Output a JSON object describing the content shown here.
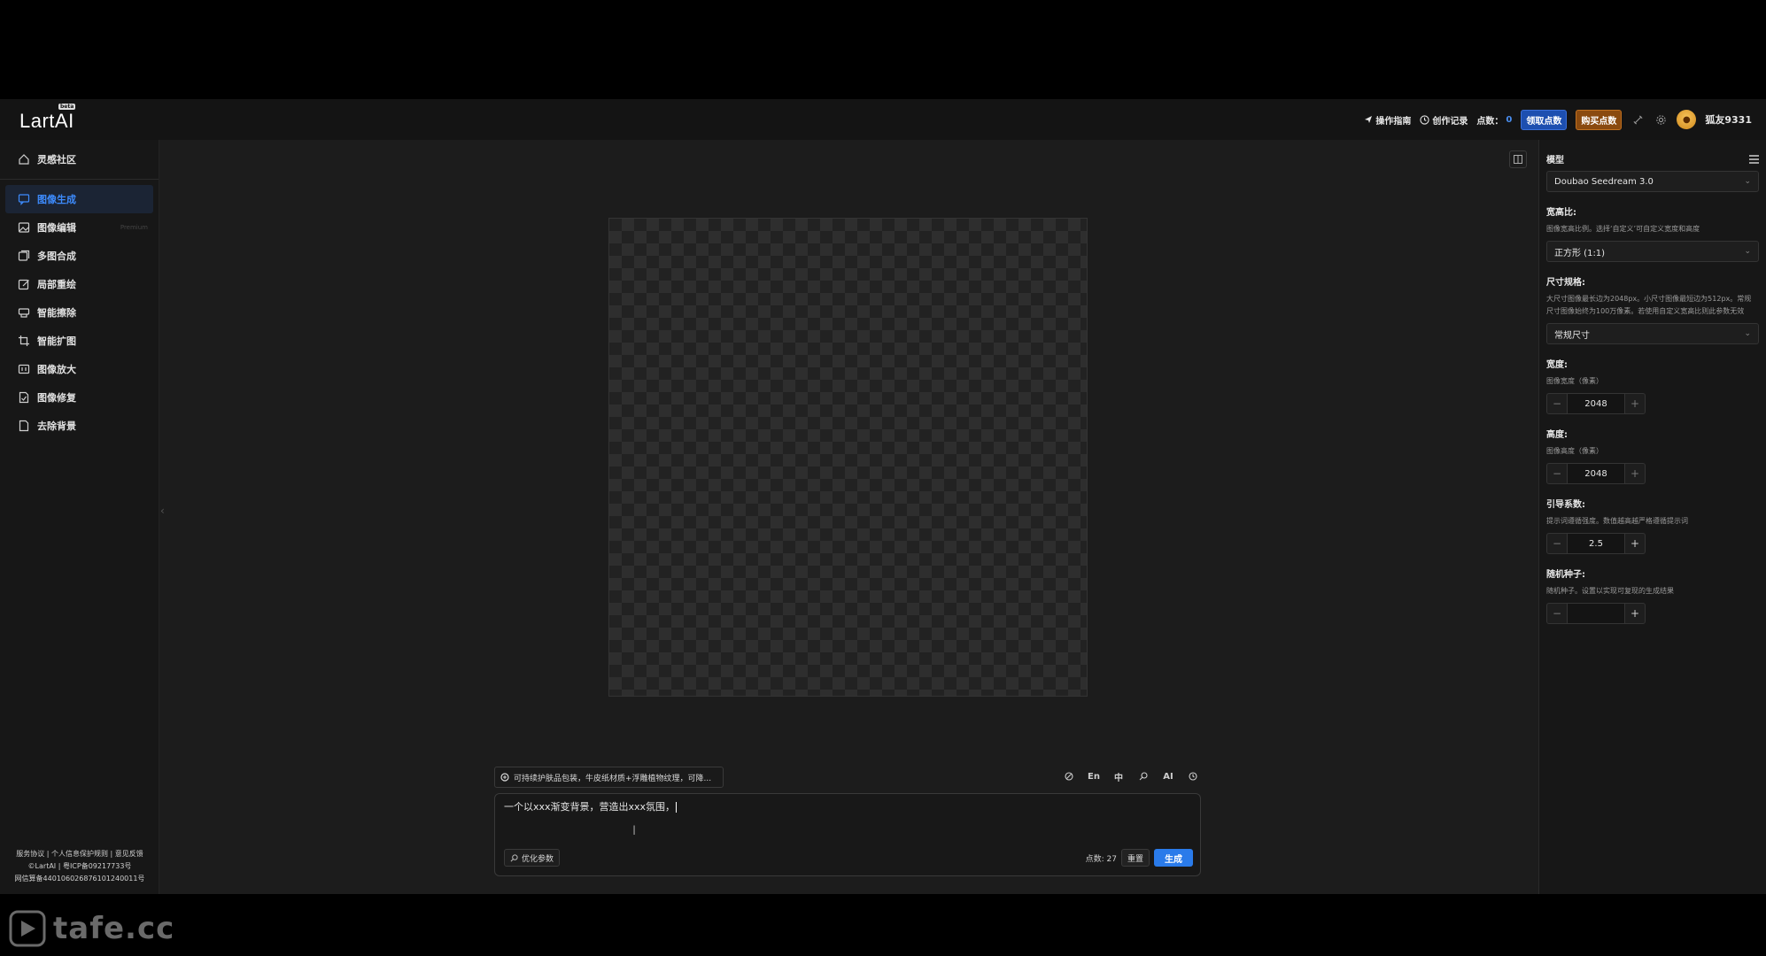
{
  "header": {
    "logo": "LartAI",
    "logo_badge": "beta",
    "guide": "操作指南",
    "history": "创作记录",
    "points_label": "点数：",
    "points_value": "0",
    "get_points": "领取点数",
    "buy_points": "购买点数",
    "username": "狐友9331"
  },
  "sidebar": {
    "community": "灵感社区",
    "items": [
      {
        "label": "图像生成"
      },
      {
        "label": "图像编辑",
        "tag": "Premium"
      },
      {
        "label": "多图合成"
      },
      {
        "label": "局部重绘"
      },
      {
        "label": "智能擦除"
      },
      {
        "label": "智能扩图"
      },
      {
        "label": "图像放大"
      },
      {
        "label": "图像修复"
      },
      {
        "label": "去除背景"
      }
    ],
    "footer": {
      "line1": "服务协议 | 个人信息保护规则 | 意见反馈",
      "line2": "©LartAI | 粤ICP备09217733号",
      "line3": "网信算备440106026876101240011号"
    }
  },
  "prompt": {
    "suggestion": "可持续护肤品包装，牛皮纸材质+浮雕植物纹理，可降...",
    "tools": {
      "en": "En",
      "zh": "中",
      "ai": "AI"
    },
    "text": "一个以xxx渐变背景，营造出xxx氛围，",
    "optimize": "优化参数",
    "cost": "点数: 27",
    "reset": "重置",
    "generate": "生成"
  },
  "settings": {
    "model_label": "模型",
    "model_value": "Doubao Seedream 3.0",
    "ratio_label": "宽高比:",
    "ratio_desc": "图像宽高比例。选择‘自定义’可自定义宽度和高度",
    "ratio_value": "正方形 (1:1)",
    "size_label": "尺寸规格:",
    "size_desc": "大尺寸图像最长边为2048px。小尺寸图像最短边为512px。常规尺寸图像始终为100万像素。若使用自定义宽高比则此参数无效",
    "size_value": "常规尺寸",
    "width_label": "宽度:",
    "width_desc": "图像宽度（像素）",
    "width_value": "2048",
    "height_label": "高度:",
    "height_desc": "图像高度（像素）",
    "height_value": "2048",
    "guidance_label": "引导系数:",
    "guidance_desc": "提示词遵循强度。数值越高越严格遵循提示词",
    "guidance_value": "2.5",
    "seed_label": "随机种子:",
    "seed_desc": "随机种子。设置以实现可复现的生成结果",
    "seed_value": ""
  },
  "watermark": "tafe.cc"
}
